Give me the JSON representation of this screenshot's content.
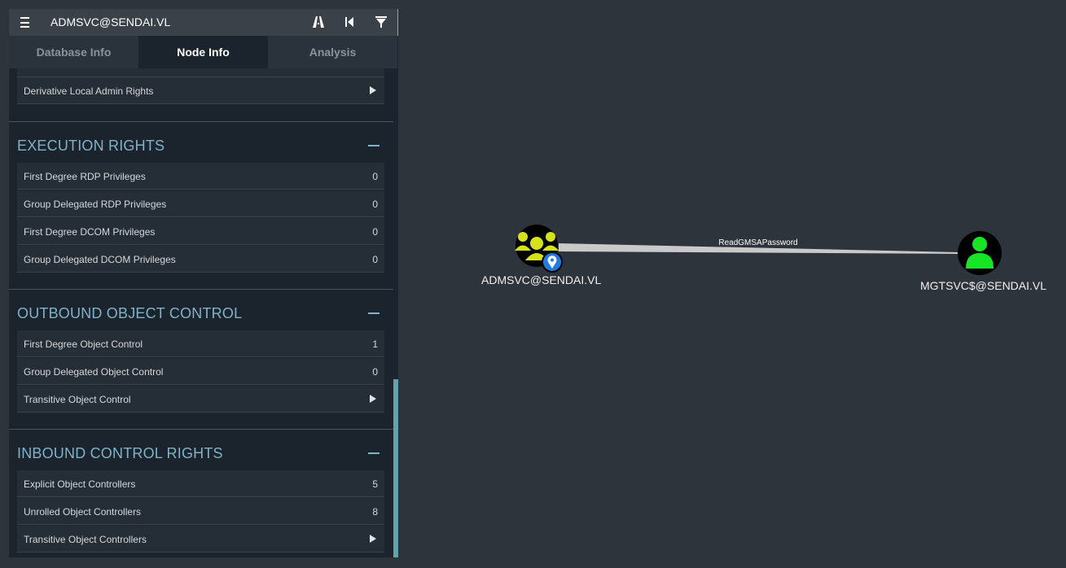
{
  "header": {
    "title": "ADMSVC@SENDAI.VL",
    "icons": [
      "menu-icon",
      "pathfinding-icon",
      "back-icon",
      "filter-icon"
    ]
  },
  "tabs": [
    {
      "label": "Database Info",
      "active": false
    },
    {
      "label": "Node Info",
      "active": true
    },
    {
      "label": "Analysis",
      "active": false
    }
  ],
  "sections": {
    "local_admin": {
      "rows": [
        {
          "label": "Derivative Local Admin Rights",
          "type": "expand"
        }
      ]
    },
    "execution_rights": {
      "title": "EXECUTION RIGHTS",
      "rows": [
        {
          "label": "First Degree RDP Privileges",
          "value": "0"
        },
        {
          "label": "Group Delegated RDP Privileges",
          "value": "0"
        },
        {
          "label": "First Degree DCOM Privileges",
          "value": "0"
        },
        {
          "label": "Group Delegated DCOM Privileges",
          "value": "0"
        }
      ]
    },
    "outbound_control": {
      "title": "OUTBOUND OBJECT CONTROL",
      "rows": [
        {
          "label": "First Degree Object Control",
          "value": "1"
        },
        {
          "label": "Group Delegated Object Control",
          "value": "0"
        },
        {
          "label": "Transitive Object Control",
          "type": "expand"
        }
      ]
    },
    "inbound_control": {
      "title": "INBOUND CONTROL RIGHTS",
      "rows": [
        {
          "label": "Explicit Object Controllers",
          "value": "5"
        },
        {
          "label": "Unrolled Object Controllers",
          "value": "8"
        },
        {
          "label": "Transitive Object Controllers",
          "type": "expand"
        }
      ]
    }
  },
  "graph": {
    "nodes": [
      {
        "label": "ADMSVC@SENDAI.VL",
        "kind": "group",
        "color": "#d6e218",
        "highlighted": true
      },
      {
        "label": "MGTSVC$@SENDAI.VL",
        "kind": "user",
        "color": "#17e625"
      }
    ],
    "edge": {
      "label": "ReadGMSAPassword"
    }
  },
  "colors": {
    "background": "#2e343b",
    "panel": "#1b232c",
    "accent": "#7fb3c9",
    "scroll_thumb": "#62a3ab",
    "marker": "#1f7be3"
  }
}
